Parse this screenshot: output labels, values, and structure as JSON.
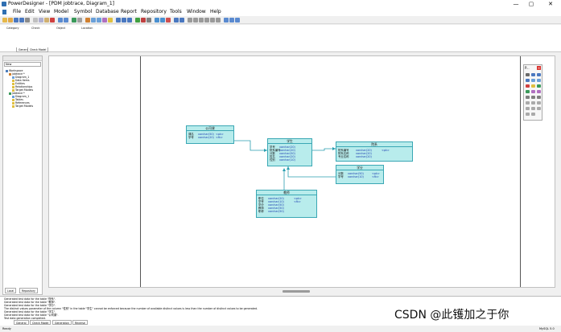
{
  "window": {
    "title": "PowerDesigner - [PDM jobtrace, Diagram_1]",
    "buttons": [
      "—",
      "▢",
      "✕"
    ]
  },
  "menu": [
    "File",
    "Edit",
    "View",
    "Model",
    "Symbol",
    "Database",
    "Report",
    "Repository",
    "Tools",
    "Window",
    "Help"
  ],
  "check_pane": {
    "columns": [
      "Category",
      "Check",
      "Object",
      "Location"
    ],
    "tabs": [
      "General",
      "Check Model"
    ]
  },
  "browser": {
    "new_label": "New",
    "tree": [
      "Workspace",
      "jobtrace *",
      "Diagram_1",
      "Data Items",
      "Entities",
      "Relationships",
      "Target Models",
      "jobtrace *",
      "Diagram_1",
      "Tables",
      "References",
      "Target Models"
    ],
    "tabs": [
      "Local",
      "Repository"
    ]
  },
  "entities": {
    "e1": {
      "title": "公司课",
      "rows": [
        [
          "课名",
          "varchar(50)",
          "<pk>"
        ],
        [
          "学号",
          "varchar(20)",
          "<fk>"
        ]
      ]
    },
    "e2": {
      "title": "学生",
      "rows": [
        [
          "学号",
          "varchar(20)",
          ""
        ],
        [
          "院系编号",
          "varchar(20)",
          ""
        ],
        [
          "分数",
          "varchar(50)",
          ""
        ],
        [
          "姓名",
          "varchar(20)",
          ""
        ],
        [
          "性别",
          "varchar(10)",
          ""
        ]
      ]
    },
    "e3": {
      "title": "院系",
      "rows": [
        [
          "院系编号",
          "varchar(20)",
          "<pk>"
        ],
        [
          "院系名称",
          "varchar(20)",
          ""
        ],
        [
          "专业名称",
          "varchar(20)",
          ""
        ]
      ]
    },
    "e4": {
      "title": "学分",
      "rows": [
        [
          "分数",
          "varchar(50)",
          "<pk>"
        ],
        [
          "学号",
          "varchar(10)",
          "<fk>"
        ]
      ]
    },
    "e5": {
      "title": "教师",
      "rows": [
        [
          "职位",
          "varchar(20)",
          "<pk>"
        ],
        [
          "学号",
          "varchar(10)",
          "<fk>"
        ],
        [
          "学分",
          "varchar(50)",
          ""
        ],
        [
          "教师",
          "varchar(50)",
          ""
        ],
        [
          "职称",
          "varchar(50)",
          ""
        ]
      ]
    }
  },
  "palette": {
    "title": "P...",
    "close": "×"
  },
  "output": {
    "lines": [
      "Generated test data for the table \"院系\".",
      "Generated test data for the table \"教师\".",
      "Generated test data for the table \"学分\".",
      "The distinct values parameter of the column \"性别\" in the table \"学生\" cannot be enforced because the number of available distinct values is less than the number of distinct values to be generated.",
      "Generated test data for the table \"学生\".",
      "Generated test data for the table \"公司课\".",
      "Test data generation completed."
    ],
    "tabs": [
      "General",
      "Check Model",
      "Generation",
      "Reverse"
    ]
  },
  "status": {
    "left": "Ready",
    "right": "MySQL 5.0"
  },
  "watermark": "CSDN @此镬加之于你",
  "colors": {
    "entity_fill": "#b8ecec",
    "entity_border": "#3aa7b4",
    "link": "#2a9fb0"
  }
}
